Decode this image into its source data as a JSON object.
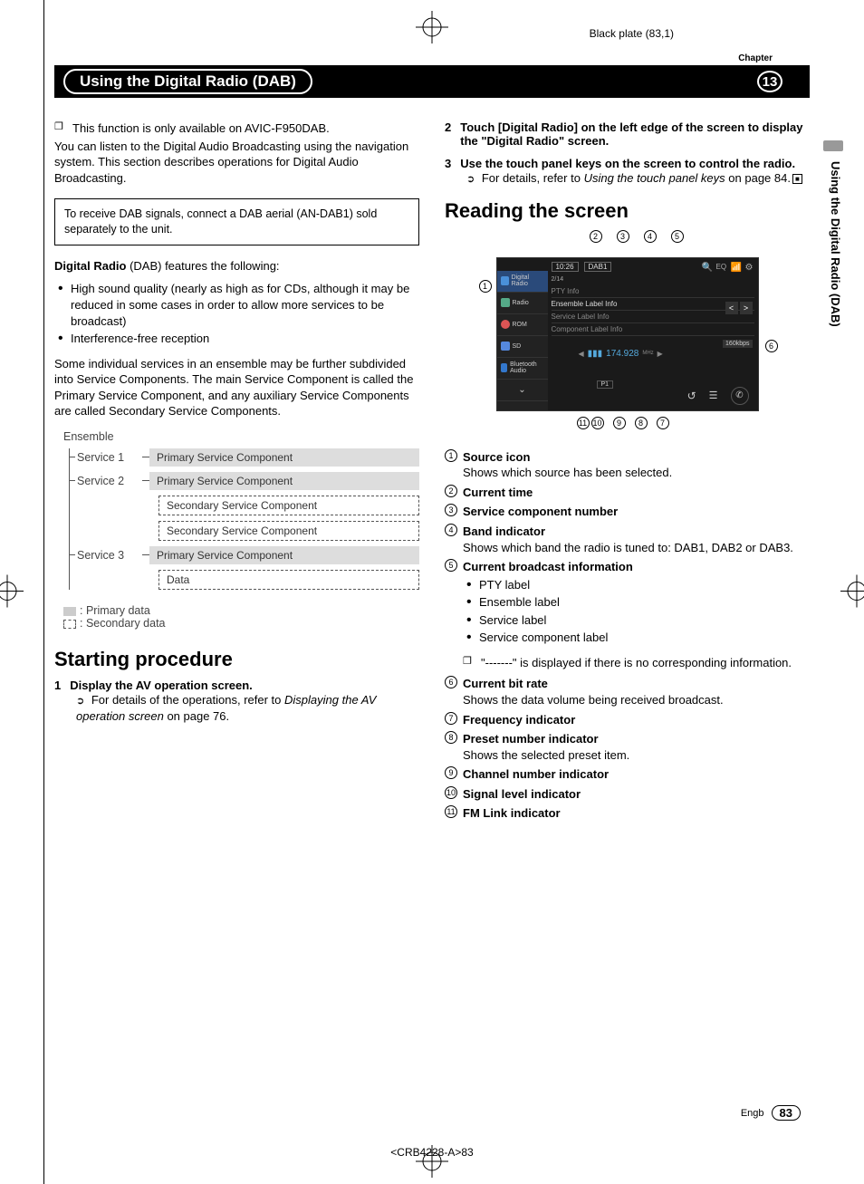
{
  "meta": {
    "black_plate": "Black plate (83,1)",
    "crb": "<CRB4228-A>83"
  },
  "header": {
    "chapter_label": "Chapter",
    "chapter_title": "Using the Digital Radio (DAB)",
    "chapter_number": "13",
    "side_tab": "Using the Digital Radio (DAB)"
  },
  "left": {
    "note1": "This function is only available on AVIC-F950DAB.",
    "intro": "You can listen to the Digital Audio Broadcasting using the navigation system. This section describes operations for Digital Audio Broadcasting.",
    "boxed": "To receive DAB signals, connect a DAB aerial (AN-DAB1) sold separately to the unit.",
    "features_lead_a": "Digital Radio",
    "features_lead_b": " (DAB) features the following:",
    "features": [
      "High sound quality (nearly as high as for CDs, although it may be reduced in some cases in order to allow more services to be broadcast)",
      "Interference-free reception"
    ],
    "subdivide": "Some individual services in an ensemble may be further subdivided into Service Components. The main Service Component is called the Primary Service Component, and any auxiliary Service Components are called Secondary Service Components.",
    "tree": {
      "root": "Ensemble",
      "s1": "Service 1",
      "s2": "Service 2",
      "s3": "Service 3",
      "primary": "Primary Service Component",
      "secondary": "Secondary Service Component",
      "data": "Data"
    },
    "legend": {
      "primary": ": Primary data",
      "secondary": ": Secondary data"
    },
    "starting_h": "Starting procedure",
    "step1_h": "Display the AV operation screen.",
    "step1_ref_a": "For details of the operations, refer to ",
    "step1_ref_i": "Displaying the AV operation screen",
    "step1_ref_b": " on page 76."
  },
  "right": {
    "step2": "Touch [Digital Radio] on the left edge of the screen to display the \"Digital Radio\" screen.",
    "step3_h": "Use the touch panel keys on the screen to control the radio.",
    "step3_ref_a": "For details, refer to ",
    "step3_ref_i": "Using the touch panel keys",
    "step3_ref_b": " on page 84.",
    "reading_h": "Reading the screen",
    "shot": {
      "src_digital": "Digital Radio",
      "src_radio": "Radio",
      "src_rom": "ROM",
      "src_sd": "SD",
      "src_bt": "Bluetooth Audio",
      "time": "10:26",
      "band": "DAB1",
      "counter": "2/14",
      "pty": "PTY Info",
      "ensemble": "Ensemble Label Info",
      "service": "Service Label Info",
      "component": "Component Label Info",
      "bitrate": "160kbps",
      "freq": "174.928",
      "freq_unit": "MHz",
      "preset": "P1"
    },
    "defs": [
      {
        "n": "1",
        "t": "Source icon",
        "d": "Shows which source has been selected."
      },
      {
        "n": "2",
        "t": "Current time",
        "d": ""
      },
      {
        "n": "3",
        "t": "Service component number",
        "d": ""
      },
      {
        "n": "4",
        "t": "Band indicator",
        "d": "Shows which band the radio is tuned to: DAB1, DAB2 or DAB3."
      },
      {
        "n": "5",
        "t": "Current broadcast information",
        "d": "",
        "bullets": [
          "PTY label",
          "Ensemble label",
          "Service label",
          "Service component label"
        ],
        "note": "\"-------\" is displayed if there is no corresponding information."
      },
      {
        "n": "6",
        "t": "Current bit rate",
        "d": "Shows the data volume being received broadcast."
      },
      {
        "n": "7",
        "t": "Frequency indicator",
        "d": ""
      },
      {
        "n": "8",
        "t": "Preset number indicator",
        "d": "Shows the selected preset item."
      },
      {
        "n": "9",
        "t": "Channel number indicator",
        "d": ""
      },
      {
        "n": "10",
        "t": "Signal level indicator",
        "d": ""
      },
      {
        "n": "11",
        "t": "FM Link indicator",
        "d": ""
      }
    ]
  },
  "footer": {
    "lang": "Engb",
    "page": "83"
  }
}
